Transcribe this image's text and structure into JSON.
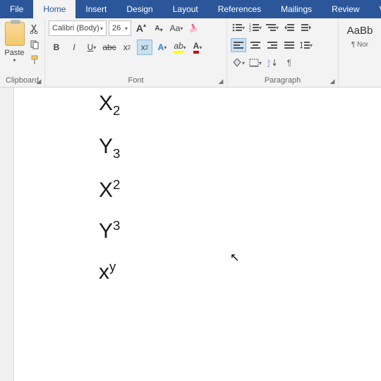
{
  "menubar": {
    "tabs": [
      "File",
      "Home",
      "Insert",
      "Design",
      "Layout",
      "References",
      "Mailings",
      "Review",
      "Vi"
    ],
    "active": "Home"
  },
  "clipboard": {
    "paste": "Paste",
    "label": "Clipboard"
  },
  "font": {
    "name": "Calibri (Body)",
    "size": "26",
    "changeCase": "Aa",
    "textColor": "A",
    "highlight": "ab",
    "effects": "A",
    "subscript": "x",
    "sub_sub": "2",
    "superscript": "x",
    "sup_sup": "2",
    "bigA": "A",
    "smallA": "A",
    "label": "Font"
  },
  "paragraph": {
    "label": "Paragraph",
    "pilcrow": "¶"
  },
  "styles": {
    "preview": "AaBb",
    "name": "¶ Nor"
  },
  "document": {
    "lines": [
      {
        "base": "X",
        "script": "2",
        "type": "sub"
      },
      {
        "base": "Y",
        "script": "3",
        "type": "sub"
      },
      {
        "base": "X",
        "script": "2",
        "type": "sup"
      },
      {
        "base": "Y",
        "script": "3",
        "type": "sup"
      },
      {
        "base": "x",
        "script": "y",
        "type": "sup"
      }
    ]
  }
}
